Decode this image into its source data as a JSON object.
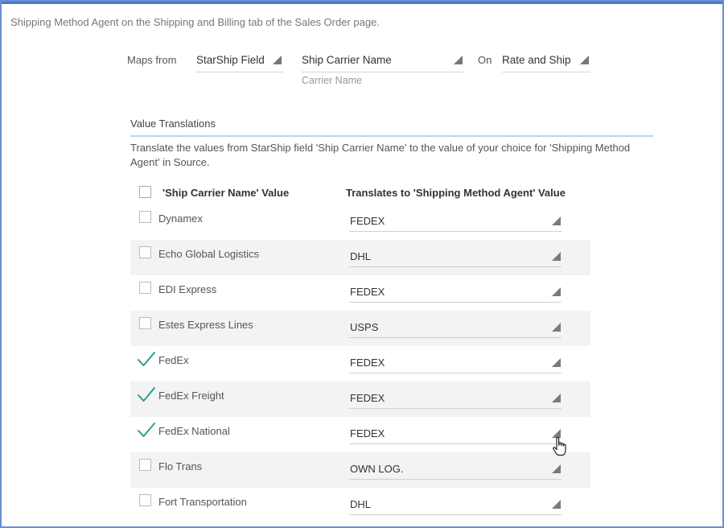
{
  "intro_text": "Shipping Method Agent on the Shipping and Billing tab of the Sales Order page.",
  "mapping": {
    "maps_from_label": "Maps from",
    "source_field": "StarShip Field",
    "target_field": "Ship Carrier Name",
    "target_sub": "Carrier Name",
    "on_label": "On",
    "on_value": "Rate and Ship"
  },
  "value_translations": {
    "title": "Value Translations",
    "description": "Translate the values from StarShip field 'Ship Carrier Name' to the value of your choice for 'Shipping Method Agent' in Source.",
    "col1_header": "'Ship Carrier Name' Value",
    "col2_header": "Translates to 'Shipping Method Agent' Value",
    "rows": [
      {
        "name": "Dynamex",
        "value": "FEDEX",
        "checked": false
      },
      {
        "name": "Echo Global Logistics",
        "value": "DHL",
        "checked": false
      },
      {
        "name": "EDI Express",
        "value": "FEDEX",
        "checked": false
      },
      {
        "name": "Estes Express Lines",
        "value": "USPS",
        "checked": false
      },
      {
        "name": "FedEx",
        "value": "FEDEX",
        "checked": true
      },
      {
        "name": "FedEx Freight",
        "value": "FEDEX",
        "checked": true
      },
      {
        "name": "FedEx National",
        "value": "FEDEX",
        "checked": true
      },
      {
        "name": "Flo Trans",
        "value": "OWN LOG.",
        "checked": false
      },
      {
        "name": "Fort Transportation",
        "value": "DHL",
        "checked": false
      }
    ]
  },
  "colors": {
    "frame_border": "#6a8fd4",
    "check_color": "#1a9a8a",
    "section_underline": "#b8d4f0",
    "alt_row": "#f3f3f3"
  },
  "icons": {
    "dropdown": "dropdown-triangle-icon",
    "check": "checkmark-icon",
    "cursor": "hand-pointer-icon"
  }
}
